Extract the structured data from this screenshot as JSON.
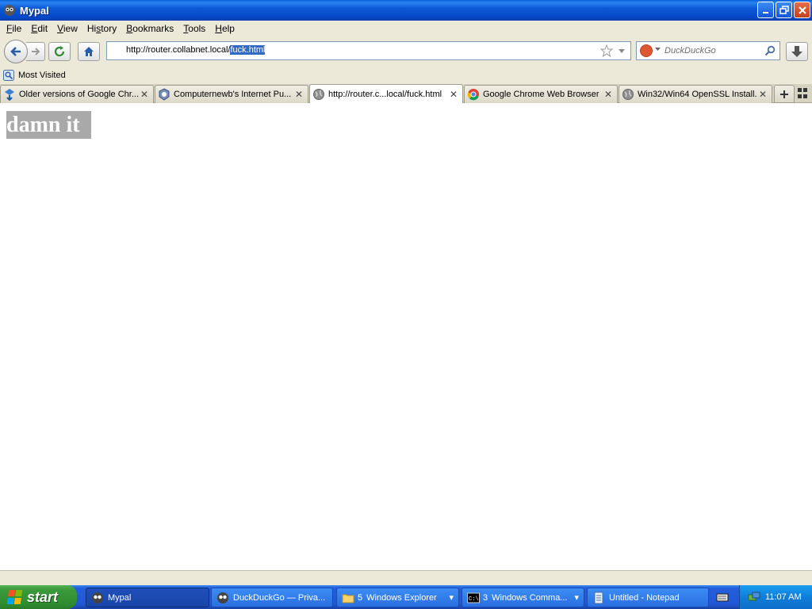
{
  "window": {
    "title": "Mypal"
  },
  "menu": [
    {
      "pre": "",
      "ul": "F",
      "post": "ile"
    },
    {
      "pre": "",
      "ul": "E",
      "post": "dit"
    },
    {
      "pre": "",
      "ul": "V",
      "post": "iew"
    },
    {
      "pre": "Hi",
      "ul": "s",
      "post": "tory"
    },
    {
      "pre": "",
      "ul": "B",
      "post": "ookmarks"
    },
    {
      "pre": "",
      "ul": "T",
      "post": "ools"
    },
    {
      "pre": "",
      "ul": "H",
      "post": "elp"
    }
  ],
  "urlbar": {
    "url_prefix": "http://router.collabnet.local/",
    "url_selected": "fuck.html"
  },
  "search": {
    "placeholder": "DuckDuckGo"
  },
  "bookmarks": {
    "most_visited": "Most Visited"
  },
  "tabs": [
    {
      "label": "Older versions of Google Chr...",
      "active": false
    },
    {
      "label": "Computernewb's Internet Pu...",
      "active": false
    },
    {
      "label": "http://router.c...local/fuck.html",
      "active": true
    },
    {
      "label": "Google Chrome Web Browser",
      "active": false
    },
    {
      "label": "Win32/Win64 OpenSSL Install...",
      "active": false
    }
  ],
  "content": {
    "heading": "damn it"
  },
  "taskbar": {
    "start_label": "start",
    "tasks": [
      {
        "label": "Mypal",
        "active": true
      },
      {
        "label": "DuckDuckGo — Priva...",
        "active": false
      },
      {
        "count": "5",
        "label": "Windows Explorer",
        "active": false
      },
      {
        "count": "3",
        "label": "Windows Comma...",
        "active": false
      },
      {
        "label": "Untitled - Notepad",
        "active": false
      }
    ],
    "clock": "11:07 AM"
  },
  "colors": {
    "title_bar": "#0548c7",
    "taskbar": "#245edb",
    "start_button": "#3a9a3b",
    "heading_bg": "#a9a9a9",
    "url_selection": "#316ac5"
  }
}
